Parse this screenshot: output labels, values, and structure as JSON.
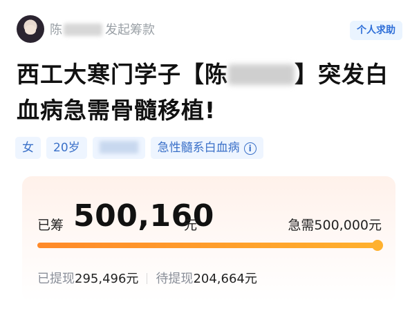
{
  "header": {
    "organizer_name": "陈",
    "organizer_action": "发起筹款",
    "help_tag": "个人求助"
  },
  "campaign": {
    "title_part1": "西工大寒门学子【陈",
    "title_part2": "】突发白血病急需骨髓移植!"
  },
  "tags": {
    "gender": "女",
    "age": "20岁",
    "disease": "急性髓系白血病",
    "info_icon": "i"
  },
  "funding": {
    "raised_label": "已筹",
    "raised_amount": "500,160",
    "raised_unit": "元",
    "needed_text": "急需500,000元",
    "progress_fraction": 1.0,
    "withdrawn_label": "已提现",
    "withdrawn_value": "295,496元",
    "pending_label": "待提现",
    "pending_value": "204,664元"
  },
  "colors": {
    "accent_blue": "#2f6fd8",
    "progress_orange": "#ff8a2a"
  }
}
